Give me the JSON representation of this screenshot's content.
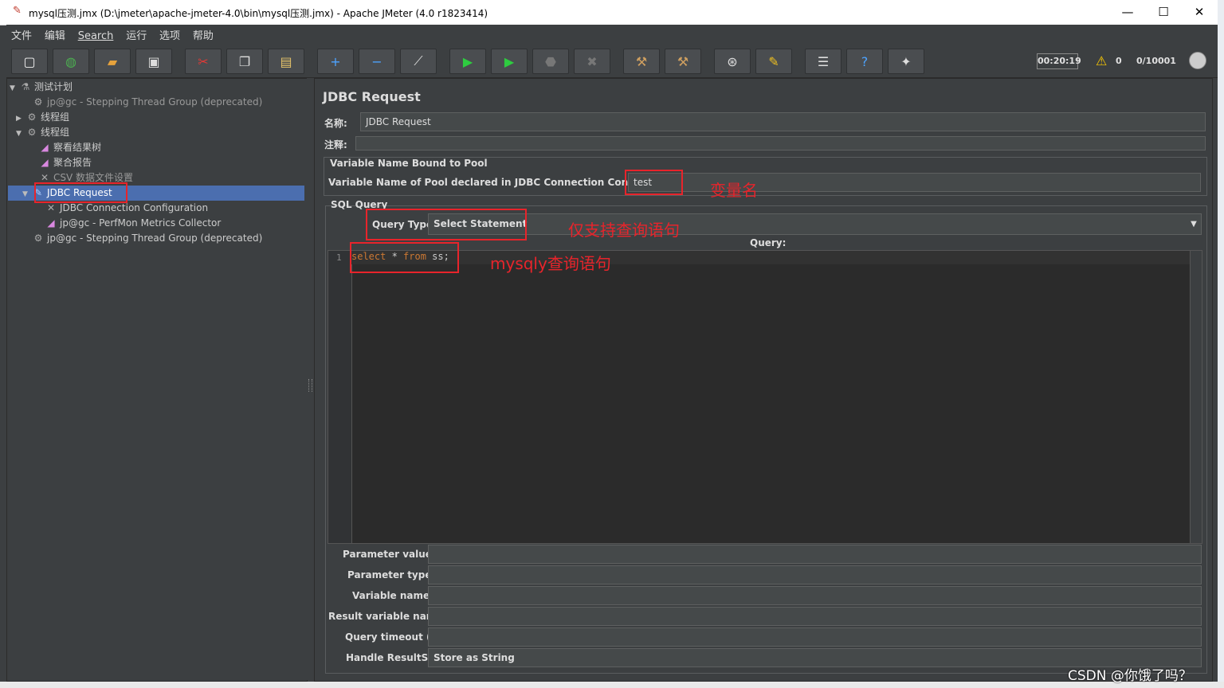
{
  "window": {
    "title": "mysql压测.jmx (D:\\jmeter\\apache-jmeter-4.0\\bin\\mysql压测.jmx) - Apache JMeter (4.0 r1823414)",
    "minimize": "—",
    "maximize": "☐",
    "close": "✕"
  },
  "menu": [
    "文件",
    "编辑",
    "Search",
    "运行",
    "选项",
    "帮助"
  ],
  "toolbar": {
    "buttons": [
      {
        "name": "new-icon",
        "glyph": "▢",
        "color": "#f2f2f2"
      },
      {
        "name": "templates-icon",
        "glyph": "◍",
        "color": "#4caf50"
      },
      {
        "name": "open-icon",
        "glyph": "▰",
        "color": "#e6a23c"
      },
      {
        "name": "save-icon",
        "glyph": "▣",
        "color": "#dddddd"
      },
      {
        "name": "cut-icon",
        "glyph": "✂",
        "color": "#e53935"
      },
      {
        "name": "copy-icon",
        "glyph": "❐",
        "color": "#dddddd"
      },
      {
        "name": "paste-icon",
        "glyph": "▤",
        "color": "#e6c36a"
      },
      {
        "name": "expand-icon",
        "glyph": "+",
        "color": "#4da3ff"
      },
      {
        "name": "collapse-icon",
        "glyph": "−",
        "color": "#4da3ff"
      },
      {
        "name": "toggle-icon",
        "glyph": "⟋",
        "color": "#dddddd"
      },
      {
        "name": "start-icon",
        "glyph": "▶",
        "color": "#2ecc40"
      },
      {
        "name": "start-no-pause-icon",
        "glyph": "▶",
        "color": "#2ecc40"
      },
      {
        "name": "stop-icon",
        "glyph": "⬣",
        "color": "#777777"
      },
      {
        "name": "shutdown-icon",
        "glyph": "✖",
        "color": "#777777"
      },
      {
        "name": "clear-icon",
        "glyph": "⚒",
        "color": "#d0a060"
      },
      {
        "name": "clear-all-icon",
        "glyph": "⚒",
        "color": "#d0a060"
      },
      {
        "name": "search-icon",
        "glyph": "⊛",
        "color": "#dddddd"
      },
      {
        "name": "reset-search-icon",
        "glyph": "✎",
        "color": "#f0c020"
      },
      {
        "name": "function-helper-icon",
        "glyph": "☰",
        "color": "#dddddd"
      },
      {
        "name": "help-icon",
        "glyph": "?",
        "color": "#4da3ff"
      },
      {
        "name": "remote-icon",
        "glyph": "✦",
        "color": "#dddddd"
      }
    ],
    "elapsed": "00:20:19",
    "warning_count": "0",
    "threads": "0/10001"
  },
  "tree": [
    {
      "label": "测试计划",
      "icon": "flask-icon",
      "glyph": "⚗",
      "toggle": "▼",
      "dim": false
    },
    {
      "label": "jp@gc - Stepping Thread Group (deprecated)",
      "icon": "gear-icon",
      "glyph": "⚙",
      "toggle": "",
      "dim": true
    },
    {
      "label": "线程组",
      "icon": "gear-icon",
      "glyph": "⚙",
      "toggle": "▶",
      "dim": false
    },
    {
      "label": "线程组",
      "icon": "gear-icon",
      "glyph": "⚙",
      "toggle": "▼",
      "dim": false
    },
    {
      "label": "察看结果树",
      "icon": "chart-icon",
      "glyph": "◢",
      "toggle": "",
      "dim": false
    },
    {
      "label": "聚合报告",
      "icon": "chart-icon",
      "glyph": "◢",
      "toggle": "",
      "dim": false
    },
    {
      "label": "CSV 数据文件设置",
      "icon": "wrench-icon",
      "glyph": "✕",
      "toggle": "",
      "dim": true
    },
    {
      "label": "JDBC Request",
      "icon": "pipette-icon",
      "glyph": "✎",
      "toggle": "▼",
      "dim": false
    },
    {
      "label": "JDBC Connection Configuration",
      "icon": "wrench-icon",
      "glyph": "✕",
      "toggle": "",
      "dim": false
    },
    {
      "label": "jp@gc - PerfMon Metrics Collector",
      "icon": "chart-icon",
      "glyph": "◢",
      "toggle": "",
      "dim": false
    },
    {
      "label": "jp@gc - Stepping Thread Group (deprecated)",
      "icon": "gear-icon",
      "glyph": "⚙",
      "toggle": "",
      "dim": false
    }
  ],
  "panel": {
    "title": "JDBC Request",
    "name_label": "名称:",
    "name_value": "JDBC Request",
    "comment_label": "注释:",
    "pool_group_title": "Variable Name Bound to Pool",
    "pool_label": "Variable Name of Pool declared in JDBC Connection Configuration:",
    "pool_value": "test",
    "sql_group_title": "SQL Query",
    "query_type_label": "Query Type:",
    "query_type_value": "Select Statement",
    "query_label": "Query:",
    "line_number": "1",
    "query_text": [
      "select",
      " * ",
      "from",
      " ss;"
    ],
    "param_values_label": "Parameter values:",
    "param_types_label": "Parameter types:",
    "variable_names_label": "Variable names:",
    "result_var_label": "Result variable name:",
    "query_timeout_label": "Query timeout (s):",
    "handle_resultset_label": "Handle ResultSet:",
    "handle_resultset_value": "Store as String"
  },
  "annotations": {
    "var_name": "变量名",
    "select_only": "仅支持查询语句",
    "mysql_query": "mysqly查询语句"
  },
  "watermark": "CSDN @你饿了吗？",
  "colors": {
    "annotation": "#e8242b",
    "selection": "#4b6eaf",
    "keyword": "#cc7832"
  }
}
